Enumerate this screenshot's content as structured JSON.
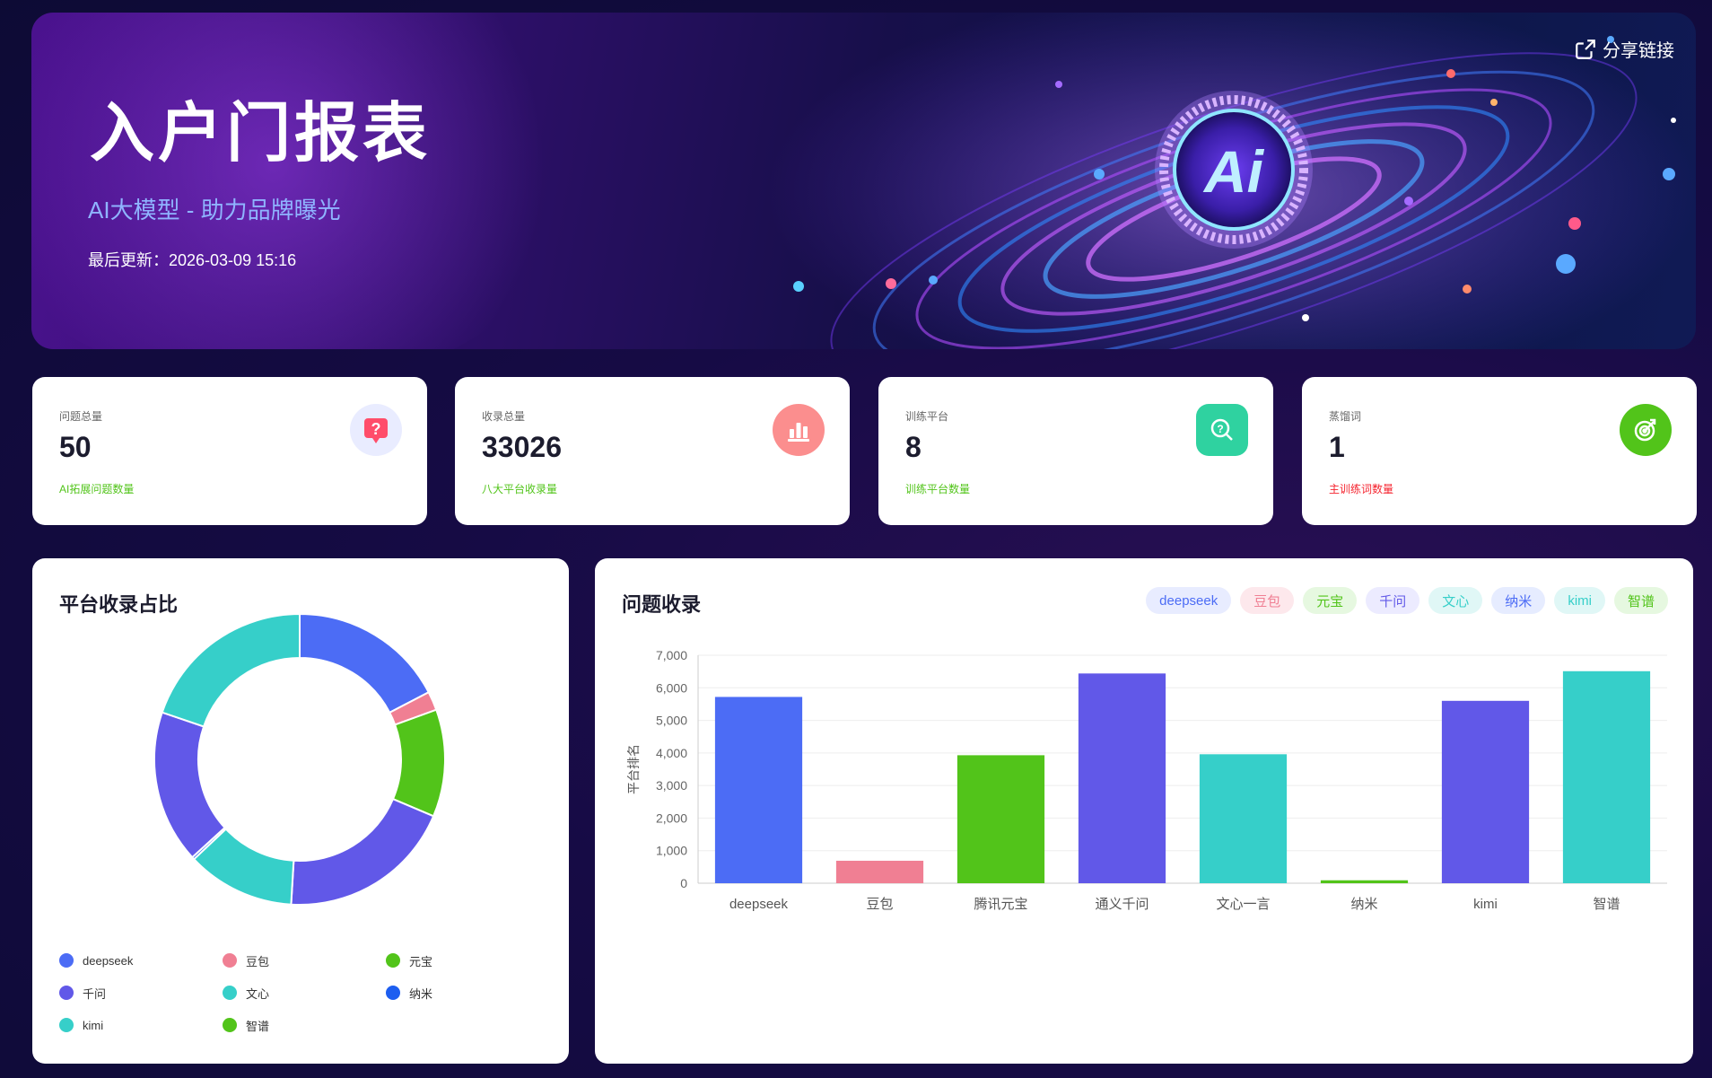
{
  "banner": {
    "title": "入户门报表",
    "subtitle": "AI大模型 - 助力品牌曝光",
    "updated": "最后更新：2026-03-09 15:16",
    "share_label": "分享链接",
    "emblem_text": "Ai"
  },
  "cards": [
    {
      "label": "问题总量",
      "value": "50",
      "note": "AI拓展问题数量",
      "note_color": "#52c41a",
      "icon": "question-bubble-icon",
      "icon_bg": "#e9ecff",
      "icon_fg": "#ff4d6a"
    },
    {
      "label": "收录总量",
      "value": "33026",
      "note": "八大平台收录量",
      "note_color": "#52c41a",
      "icon": "bar-chart-icon",
      "icon_bg": "#fb8e8e",
      "icon_fg": "#ffffff"
    },
    {
      "label": "训练平台",
      "value": "8",
      "note": "训练平台数量",
      "note_color": "#52c41a",
      "icon": "search-question-icon",
      "icon_bg": "#2fd2a0",
      "icon_fg": "#ffffff"
    },
    {
      "label": "蒸馏词",
      "value": "1",
      "note": "主训练词数量",
      "note_color": "#f5222d",
      "icon": "target-icon",
      "icon_bg": "#52c41a",
      "icon_fg": "#ffffff"
    }
  ],
  "donut_panel": {
    "title": "平台收录占比",
    "legend": [
      {
        "name": "deepseek",
        "color": "#4c6cf5"
      },
      {
        "name": "豆包",
        "color": "#f07f93"
      },
      {
        "name": "元宝",
        "color": "#52c41a"
      },
      {
        "name": "千问",
        "color": "#6158e8"
      },
      {
        "name": "文心",
        "color": "#36cfc9"
      },
      {
        "name": "纳米",
        "color": "#1d5ef0"
      },
      {
        "name": "kimi",
        "color": "#36cfc9"
      },
      {
        "name": "智谱",
        "color": "#52c41a"
      }
    ]
  },
  "bar_panel": {
    "title": "问题收录",
    "chips": [
      {
        "label": "deepseek",
        "bg": "#e8ecff",
        "fg": "#4c6cf5"
      },
      {
        "label": "豆包",
        "bg": "#fde8ec",
        "fg": "#f07f93"
      },
      {
        "label": "元宝",
        "bg": "#e6f8e0",
        "fg": "#52c41a"
      },
      {
        "label": "千问",
        "bg": "#ecebff",
        "fg": "#6158e8"
      },
      {
        "label": "文心",
        "bg": "#e0f7f6",
        "fg": "#36cfc9"
      },
      {
        "label": "纳米",
        "bg": "#e6ecff",
        "fg": "#4c6cf5"
      },
      {
        "label": "kimi",
        "bg": "#e0f7f6",
        "fg": "#36cfc9"
      },
      {
        "label": "智谱",
        "bg": "#e6f8e0",
        "fg": "#52c41a"
      }
    ]
  },
  "chart_data": [
    {
      "type": "pie",
      "title": "平台收录占比",
      "legend_position": "bottom",
      "series": [
        {
          "name": "deepseek",
          "value": 5720,
          "color": "#4c6cf5"
        },
        {
          "name": "豆包",
          "value": 690,
          "color": "#f07f93"
        },
        {
          "name": "元宝",
          "value": 3930,
          "color": "#52c41a"
        },
        {
          "name": "千问",
          "value": 6440,
          "color": "#6158e8"
        },
        {
          "name": "文心",
          "value": 3960,
          "color": "#36cfc9"
        },
        {
          "name": "纳米",
          "value": 90,
          "color": "#1d5ef0"
        },
        {
          "name": "kimi",
          "value": 5600,
          "color": "#6158e8"
        },
        {
          "name": "智谱",
          "value": 6510,
          "color": "#36cfc9"
        }
      ]
    },
    {
      "type": "bar",
      "title": "问题收录",
      "ylabel": "平台排名",
      "xlabel": "",
      "ylim": [
        0,
        7000
      ],
      "yticks": [
        0,
        1000,
        2000,
        3000,
        4000,
        5000,
        6000,
        7000
      ],
      "ytick_labels": [
        "0",
        "1,000",
        "2,000",
        "3,000",
        "4,000",
        "5,000",
        "6,000",
        "7,000"
      ],
      "grid": true,
      "categories": [
        "deepseek",
        "豆包",
        "腾讯元宝",
        "通义千问",
        "文心一言",
        "纳米",
        "kimi",
        "智谱"
      ],
      "values": [
        5720,
        690,
        3930,
        6440,
        3960,
        90,
        5600,
        6510
      ],
      "colors": [
        "#4c6cf5",
        "#f07f93",
        "#52c41a",
        "#6158e8",
        "#36cfc9",
        "#52c41a",
        "#6158e8",
        "#36cfc9"
      ]
    }
  ]
}
